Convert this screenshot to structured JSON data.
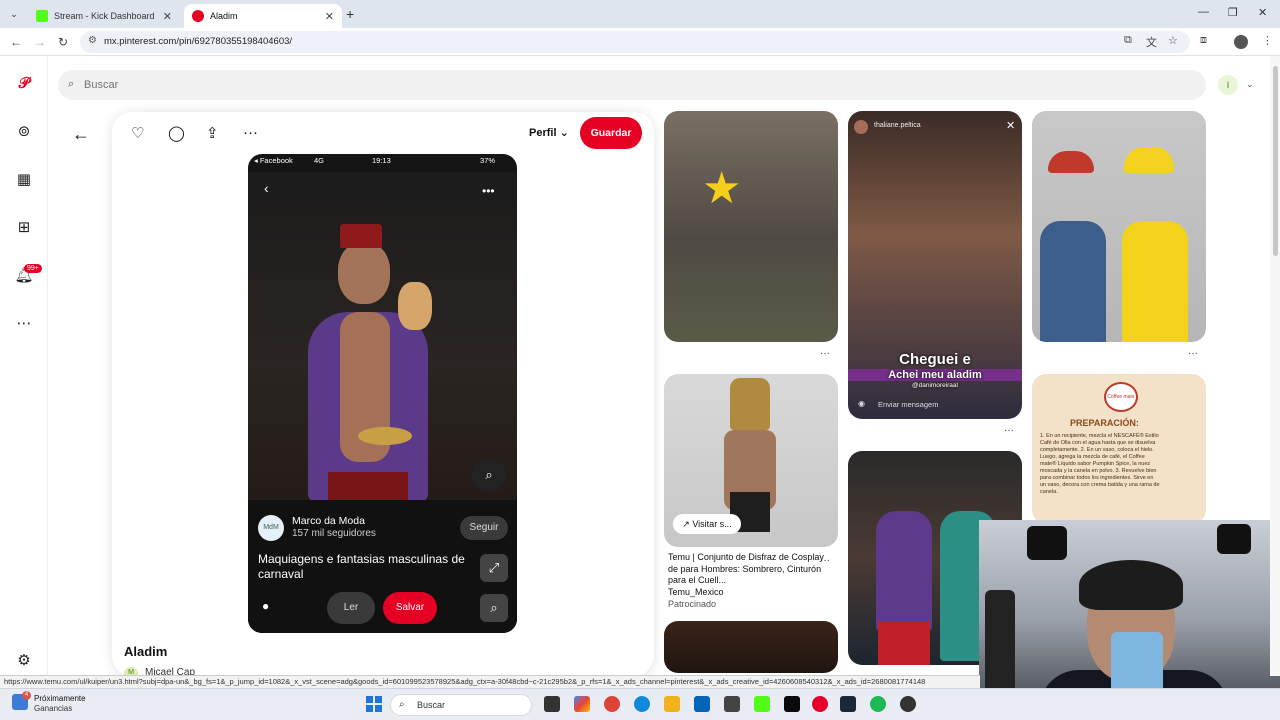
{
  "browser": {
    "tabs": [
      {
        "label": "Stream - Kick Dashboard",
        "active": false,
        "favicon_color": "#53fc18"
      },
      {
        "label": "Aladim",
        "active": true,
        "favicon_color": "#e60023"
      }
    ],
    "url": "mx.pinterest.com/pin/692780355198404603/"
  },
  "search": {
    "placeholder": "Buscar"
  },
  "account": {
    "initial": "I"
  },
  "rail": {
    "notifications_badge": "99+"
  },
  "pin": {
    "profile_label": "Perfil",
    "save_label": "Guardar",
    "title": "Aladim",
    "author": "Micael Cap",
    "author_initial": "M",
    "phone": {
      "status_app": "◂ Facebook",
      "status_signal": "4G",
      "status_time": "19:13",
      "status_battery": "37%",
      "channel_initial": "MdM",
      "channel_name": "Marco da Moda",
      "channel_followers": "157 mil seguidores",
      "follow_label": "Seguir",
      "caption": "Maquiagens e fantasias masculinas de carnaval",
      "read_label": "Ler",
      "save_label": "Salvar"
    }
  },
  "grid": {
    "tile2_line1": "Cheguei e",
    "tile2_line2": "Achei meu aladim",
    "tile2_user": "thaliane.peltica",
    "tile2_handle": "@danimoreiraal",
    "tile2_message": "Enviar mensagem",
    "visit_label": "Visitar s...",
    "ad_title": "Temu | Conjunto de Disfraz de Cosplay de para Hombres: Sombrero, Cinturón para el Cuell...",
    "ad_brand": "Temu_Mexico",
    "ad_sponsored": "Patrocinado",
    "recipe_logo": "Coffee mate",
    "recipe_title": "PREPARACIÓN:",
    "recipe_body": "1. En un recipiente, mezcla el NESCAFÉ® Estilo Café de Olla con el agua hasta que se disuelva completamente. 2. En un vaso, coloca el hielo. Luego, agrega la mezcla de café, el Coffee mate® Líquido sabor Pumpkin Spice, la nuez moscada y la canela en polvo. 3. Revuelve bien para combinar todos los ingredientes. Sirve en un vaso, decora con crema batida y una rama de canela.",
    "more": "···"
  },
  "statusbar": {
    "link": "https://www.temu.com/ul/kuiper/un3.html?subj=dpa-un&_bg_fs=1&_p_jump_id=1082&_x_vst_scene=adg&goods_id=601099523578925&adg_ctx=a-30f48cbd~c-21c295b2&_p_rfs=1&_x_ads_channel=pinterest&_x_ads_creative_id=4260608540312&_x_ads_id=2680081774148"
  },
  "taskbar": {
    "weather_title": "Próximamente",
    "weather_sub": "Ganancias",
    "weather_badge": "4",
    "search_label": "Buscar"
  }
}
